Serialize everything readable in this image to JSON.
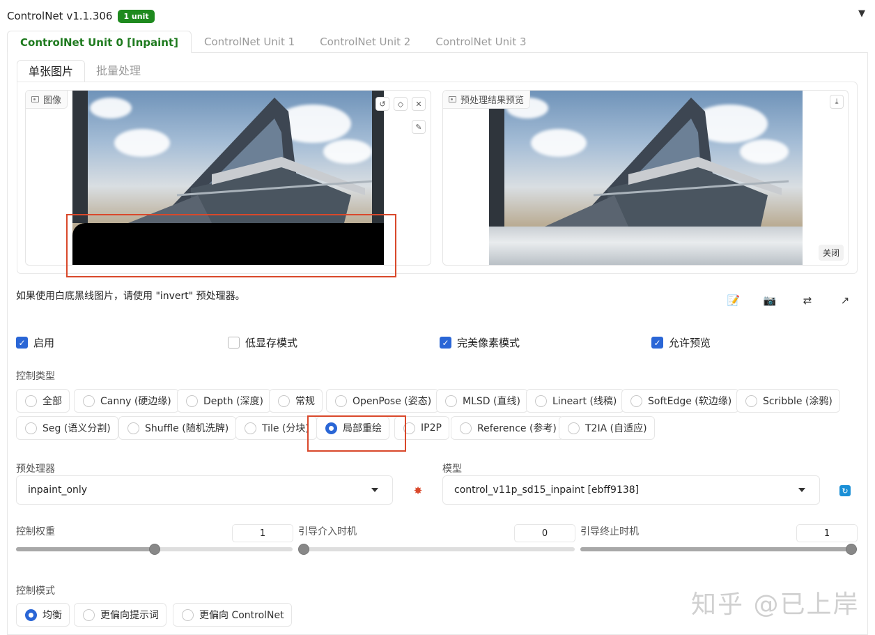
{
  "header": {
    "title": "ControlNet v1.1.306",
    "badge": "1 unit",
    "collapse_icon": "triangle-down-icon"
  },
  "unit_tabs": [
    {
      "label": "ControlNet Unit 0 [Inpaint]",
      "active": true
    },
    {
      "label": "ControlNet Unit 1"
    },
    {
      "label": "ControlNet Unit 2"
    },
    {
      "label": "ControlNet Unit 3"
    }
  ],
  "image_tabs": [
    {
      "label": "单张图片",
      "active": true
    },
    {
      "label": "批量处理"
    }
  ],
  "input_image": {
    "label": "图像",
    "tools": [
      "undo-icon",
      "eraser-icon",
      "close-icon",
      "brush-icon"
    ]
  },
  "preview": {
    "label": "预处理结果预览",
    "close_label": "关闭",
    "download_icon": "download-icon"
  },
  "hint": "如果使用白底黑线图片，请使用 \"invert\" 预处理器。",
  "action_icons": [
    "edit-icon",
    "camera-icon",
    "swap-icon",
    "send-dimensions-icon"
  ],
  "checks": {
    "enable": {
      "label": "启用",
      "checked": true
    },
    "low_vram": {
      "label": "低显存模式",
      "checked": false
    },
    "pixel_perfect": {
      "label": "完美像素模式",
      "checked": true
    },
    "allow_preview": {
      "label": "允许预览",
      "checked": true
    }
  },
  "control_type": {
    "label": "控制类型",
    "options": [
      "全部",
      "Canny (硬边缘)",
      "Depth (深度)",
      "常规",
      "OpenPose (姿态)",
      "MLSD (直线)",
      "Lineart (线稿)",
      "SoftEdge (软边缘)",
      "Scribble (涂鸦)",
      "Seg (语义分割)",
      "Shuffle (随机洗牌)",
      "Tile (分块)",
      "局部重绘",
      "IP2P",
      "Reference (参考)",
      "T2IA (自适应)"
    ],
    "selected": "局部重绘"
  },
  "preprocessor": {
    "label": "预处理器",
    "value": "inpaint_only",
    "run_icon": "explosion-icon"
  },
  "model": {
    "label": "模型",
    "value": "control_v11p_sd15_inpaint [ebff9138]",
    "refresh_icon": "refresh-icon"
  },
  "sliders": {
    "weight": {
      "label": "控制权重",
      "value": "1",
      "fraction": 0.5
    },
    "start": {
      "label": "引导介入时机",
      "value": "0",
      "fraction": 0.0
    },
    "end": {
      "label": "引导终止时机",
      "value": "1",
      "fraction": 1.0
    }
  },
  "control_mode": {
    "label": "控制模式",
    "options": [
      "均衡",
      "更偏向提示词",
      "更偏向 ControlNet"
    ],
    "selected": "均衡"
  },
  "watermark": "知乎 @已上岸",
  "colors": {
    "accent": "#2a66d6",
    "active_tab": "#1e7a1e",
    "badge": "#1e8a1e",
    "highlight": "#d9482b"
  }
}
